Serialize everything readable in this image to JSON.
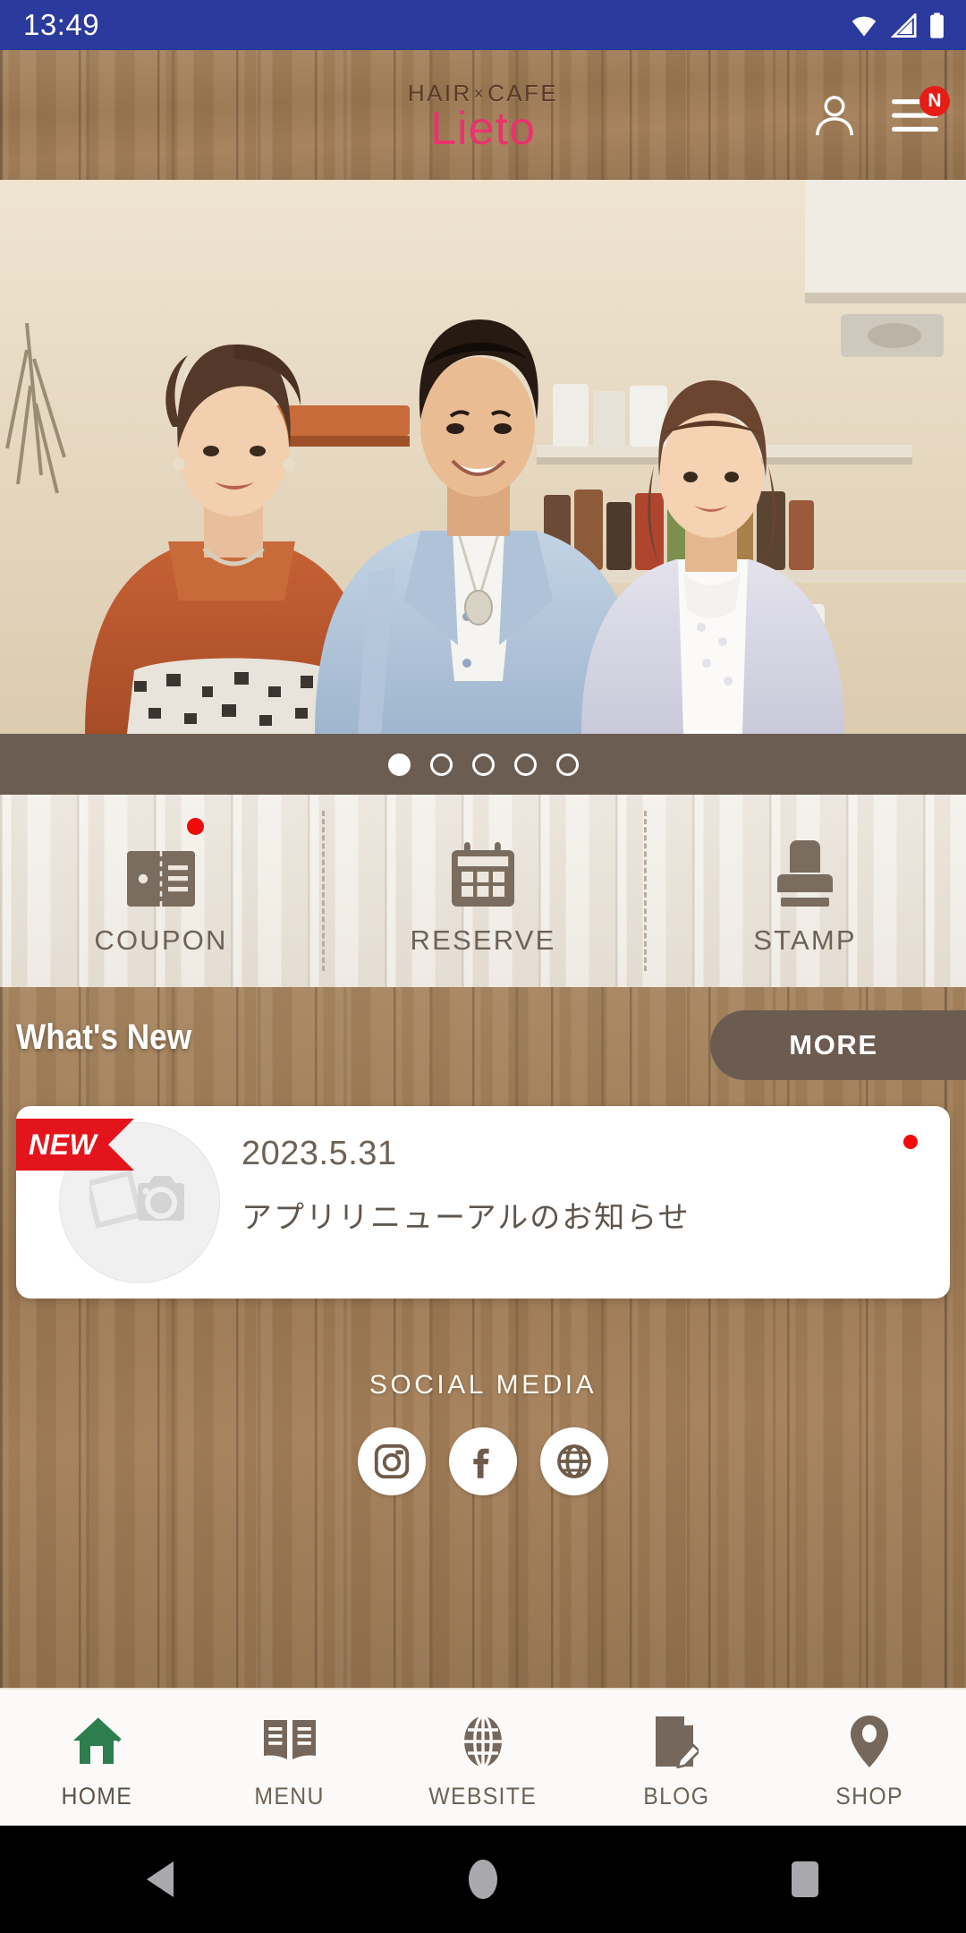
{
  "status_bar": {
    "time": "13:49",
    "icons": [
      "wifi-icon",
      "cellular-signal-icon",
      "battery-icon"
    ],
    "background_color": "#2B3A9C"
  },
  "app_header": {
    "logo_top": "HAIR",
    "logo_separator": "×",
    "logo_top_2": "CAFE",
    "logo_main": "Lieto",
    "logo_main_color": "#E8336E",
    "account_icon": "person-icon",
    "menu_icon": "hamburger-menu-icon",
    "menu_badge": "N",
    "menu_badge_color": "#E41E17"
  },
  "hero": {
    "alt": "three-salon-staff-standing-in-shop",
    "carousel": {
      "total_dots": 5,
      "active_index": 0
    }
  },
  "quick_actions": [
    {
      "label": "COUPON",
      "icon": "coupon-ticket-icon",
      "has_badge": true
    },
    {
      "label": "RESERVE",
      "icon": "calendar-icon",
      "has_badge": false
    },
    {
      "label": "STAMP",
      "icon": "rubber-stamp-icon",
      "has_badge": false
    }
  ],
  "news": {
    "section_title": "What's New",
    "more_label": "MORE",
    "items": [
      {
        "ribbon": "NEW",
        "date": "2023.5.31",
        "title": "アプリリニューアルのお知らせ",
        "thumbnail_icon": "photo-camera-placeholder-icon",
        "has_unread_dot": true
      }
    ]
  },
  "social": {
    "label": "SOCIAL MEDIA",
    "links": [
      {
        "name": "instagram-icon"
      },
      {
        "name": "facebook-icon"
      },
      {
        "name": "website-globe-icon"
      }
    ]
  },
  "bottom_nav": {
    "active": "HOME",
    "items": [
      {
        "label": "HOME",
        "icon": "house-icon",
        "color": "#2E7D4F"
      },
      {
        "label": "MENU",
        "icon": "open-book-icon",
        "color": "#75675C"
      },
      {
        "label": "WEBSITE",
        "icon": "globe-icon",
        "color": "#75675C"
      },
      {
        "label": "BLOG",
        "icon": "document-pen-icon",
        "color": "#75675C"
      },
      {
        "label": "SHOP",
        "icon": "map-pin-icon",
        "color": "#75675C"
      }
    ]
  },
  "android_nav": {
    "back": "back-triangle-icon",
    "home": "home-circle-icon",
    "recents": "recents-square-icon"
  },
  "colors": {
    "wood_dark": "#9D7B55",
    "wood_light": "#EDE7DF",
    "brown_accent": "#6C5B50",
    "red_badge": "#E3141B"
  }
}
